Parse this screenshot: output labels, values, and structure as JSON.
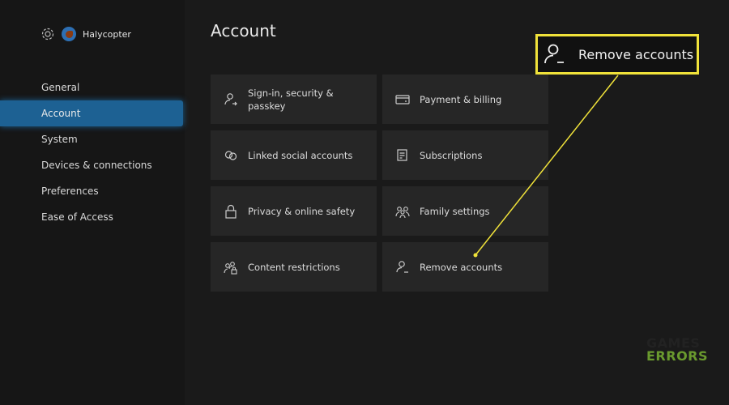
{
  "profile": {
    "name": "Halycopter"
  },
  "sidebar": {
    "items": [
      {
        "label": "General"
      },
      {
        "label": "Account",
        "active": true
      },
      {
        "label": "System"
      },
      {
        "label": "Devices & connections"
      },
      {
        "label": "Preferences"
      },
      {
        "label": "Ease of Access"
      }
    ]
  },
  "main": {
    "title": "Account",
    "tiles": [
      {
        "label": "Sign-in, security & passkey",
        "icon": "person-arrow-icon"
      },
      {
        "label": "Payment & billing",
        "icon": "credit-card-icon"
      },
      {
        "label": "Linked social accounts",
        "icon": "link-icon"
      },
      {
        "label": "Subscriptions",
        "icon": "document-icon"
      },
      {
        "label": "Privacy & online safety",
        "icon": "lock-icon"
      },
      {
        "label": "Family settings",
        "icon": "family-icon"
      },
      {
        "label": "Content restrictions",
        "icon": "people-lock-icon"
      },
      {
        "label": "Remove accounts",
        "icon": "person-minus-icon"
      }
    ]
  },
  "callout": {
    "label": "Remove accounts",
    "color": "#f0e23a"
  },
  "watermark": {
    "line1": "GAMES",
    "line2": "ERRORS",
    "accent": "#6a9a2e"
  },
  "colors": {
    "accent": "#1d6193"
  }
}
